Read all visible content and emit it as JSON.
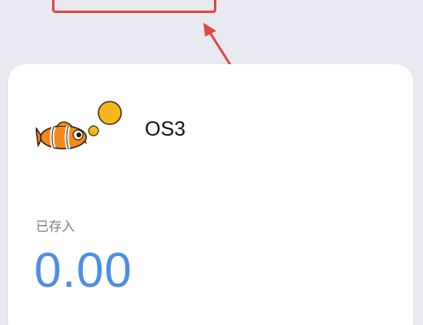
{
  "annotation": {
    "color": "#e0483e"
  },
  "card": {
    "title": "OS3",
    "deposit_label": "已存入",
    "deposit_value": "0.00",
    "value_color": "#4c8ee6",
    "mascot_icon": "clownfish-bubbles-icon"
  }
}
